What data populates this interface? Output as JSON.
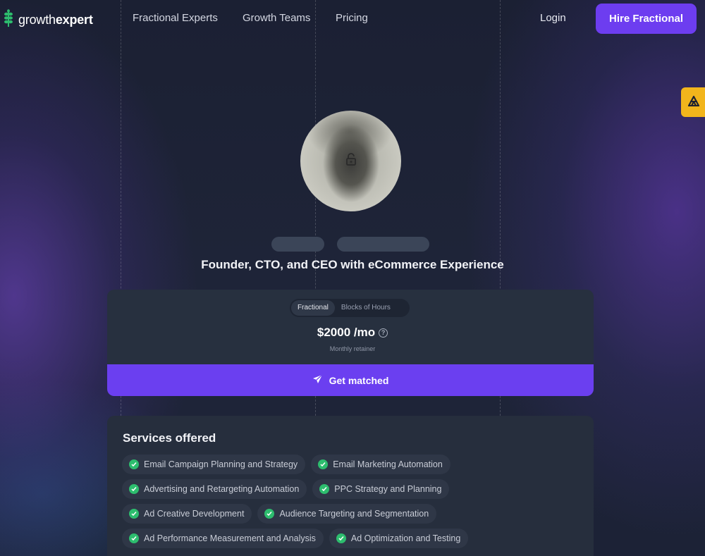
{
  "brand": {
    "name_light": "growth",
    "name_bold": "expert",
    "accent": "#2dbd6e",
    "primary": "#6d3df0"
  },
  "nav": {
    "links": [
      "Fractional Experts",
      "Growth Teams",
      "Pricing"
    ],
    "login": "Login",
    "cta": "Hire Fractional"
  },
  "side_tab": {
    "icon": "lightning-icon",
    "color": "#f2b51c"
  },
  "profile": {
    "avatar_icon": "lock-icon",
    "headline": "Founder, CTO, and CEO with eCommerce Experience"
  },
  "pricing": {
    "tabs": [
      "Fractional",
      "Blocks of Hours"
    ],
    "active_tab": "Fractional",
    "price": "$2000 /mo",
    "help_icon": "question-icon",
    "subtitle": "Monthly retainer",
    "cta": "Get matched",
    "cta_icon": "send-icon"
  },
  "services": {
    "title": "Services offered",
    "rows": [
      [
        "Email Campaign Planning and Strategy",
        "Email Marketing Automation"
      ],
      [
        "Advertising and Retargeting Automation",
        "PPC Strategy and Planning"
      ],
      [
        "Ad Creative Development",
        "Audience Targeting and Segmentation"
      ],
      [
        "Ad Performance Measurement and Analysis",
        "Ad Optimization and Testing"
      ]
    ]
  }
}
